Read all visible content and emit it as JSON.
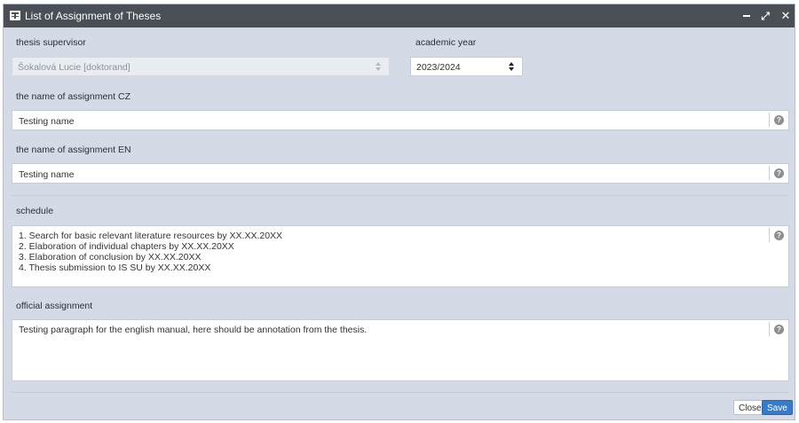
{
  "window": {
    "title": "List of Assignment of Theses",
    "minimize_icon": "minimize-icon",
    "maximize_icon": "expand-icon",
    "close_icon": "close-icon",
    "max_glyph": "⤢",
    "close_glyph": "✕"
  },
  "form": {
    "supervisor": {
      "label": "thesis supervisor",
      "value": "Šokalová Lucie [doktorand]"
    },
    "year": {
      "label": "academic year",
      "value": "2023/2024"
    },
    "name_cz": {
      "label": "the name of assignment CZ",
      "value": "Testing name"
    },
    "name_en": {
      "label": "the name of assignment EN",
      "value": "Testing name"
    },
    "schedule": {
      "label": "schedule",
      "lines": [
        "1. Search for basic relevant literature resources by XX.XX.20XX",
        "2. Elaboration of individual chapters by XX.XX.20XX",
        "3. Elaboration of conclusion by XX.XX.20XX",
        "4. Thesis submission to IS SU by XX.XX.20XX"
      ]
    },
    "official": {
      "label": "official assignment",
      "value": "Testing paragraph for the english manual, here should be annotation from the thesis."
    },
    "help_glyph": "?"
  },
  "footer": {
    "close_label": "Close",
    "save_label": "Save"
  },
  "colors": {
    "titlebar": "#4a4e55",
    "panel": "#d4dbe6",
    "save_button": "#3a7bc8"
  }
}
